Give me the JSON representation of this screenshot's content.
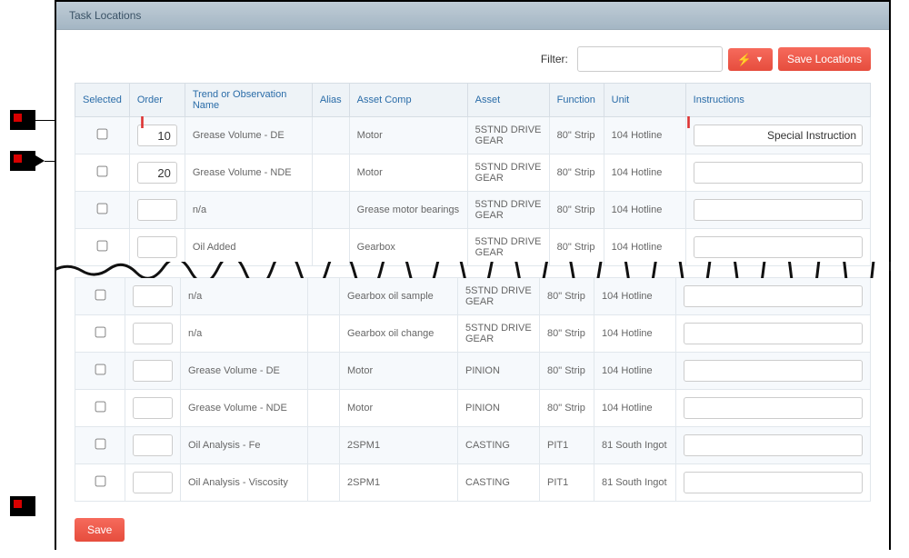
{
  "panel": {
    "title": "Task Locations"
  },
  "toolbar": {
    "filter_label": "Filter:",
    "filter_value": "",
    "bolt_glyph": "⚡",
    "caret_glyph": "▼",
    "save_locations_label": "Save Locations"
  },
  "columns": {
    "selected": "Selected",
    "order": "Order",
    "trend": "Trend or Observation Name",
    "alias": "Alias",
    "asset_comp": "Asset Comp",
    "asset": "Asset",
    "function": "Function",
    "unit": "Unit",
    "instructions": "Instructions"
  },
  "rows_top": [
    {
      "order": "10",
      "trend": "Grease Volume - DE",
      "alias": "",
      "asset_comp": "Motor",
      "asset": "5STND DRIVE GEAR",
      "function": "80\" Strip",
      "unit": "104 Hotline",
      "instr": "Special Instruction"
    },
    {
      "order": "20",
      "trend": "Grease Volume - NDE",
      "alias": "",
      "asset_comp": "Motor",
      "asset": "5STND DRIVE GEAR",
      "function": "80\" Strip",
      "unit": "104 Hotline",
      "instr": ""
    },
    {
      "order": "",
      "trend": "n/a",
      "alias": "",
      "asset_comp": "Grease motor bearings",
      "asset": "5STND DRIVE GEAR",
      "function": "80\" Strip",
      "unit": "104 Hotline",
      "instr": ""
    },
    {
      "order": "",
      "trend": "Oil Added",
      "alias": "",
      "asset_comp": "Gearbox",
      "asset": "5STND DRIVE GEAR",
      "function": "80\" Strip",
      "unit": "104 Hotline",
      "instr": ""
    }
  ],
  "rows_bottom": [
    {
      "order": "",
      "trend": "n/a",
      "alias": "",
      "asset_comp": "Gearbox oil sample",
      "asset": "5STND DRIVE GEAR",
      "function": "80\" Strip",
      "unit": "104 Hotline",
      "instr": ""
    },
    {
      "order": "",
      "trend": "n/a",
      "alias": "",
      "asset_comp": "Gearbox oil change",
      "asset": "5STND DRIVE GEAR",
      "function": "80\" Strip",
      "unit": "104 Hotline",
      "instr": ""
    },
    {
      "order": "",
      "trend": "Grease Volume - DE",
      "alias": "",
      "asset_comp": "Motor",
      "asset": "PINION",
      "function": "80\" Strip",
      "unit": "104 Hotline",
      "instr": ""
    },
    {
      "order": "",
      "trend": "Grease Volume - NDE",
      "alias": "",
      "asset_comp": "Motor",
      "asset": "PINION",
      "function": "80\" Strip",
      "unit": "104 Hotline",
      "instr": ""
    },
    {
      "order": "",
      "trend": "Oil Analysis - Fe",
      "alias": "",
      "asset_comp": "2SPM1",
      "asset": "CASTING",
      "function": "PIT1",
      "unit": "81 South Ingot",
      "instr": ""
    },
    {
      "order": "",
      "trend": "Oil Analysis - Viscosity",
      "alias": "",
      "asset_comp": "2SPM1",
      "asset": "CASTING",
      "function": "PIT1",
      "unit": "81 South Ingot",
      "instr": ""
    }
  ],
  "footer": {
    "save_label": "Save"
  }
}
